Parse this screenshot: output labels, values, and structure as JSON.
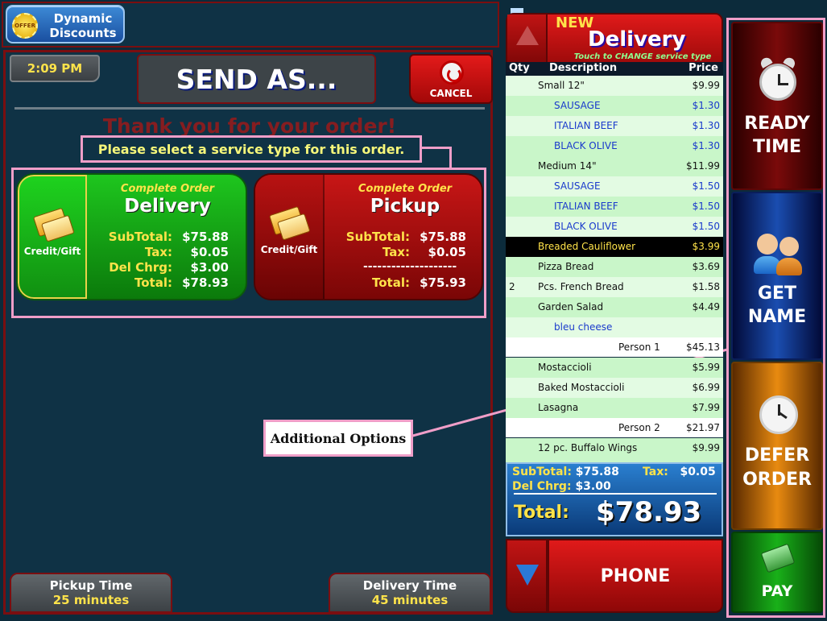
{
  "top": {
    "dynamic_discounts": "Dynamic Discounts",
    "offer_badge": "OFFER"
  },
  "header": {
    "time": "2:09 PM",
    "send_as": "SEND AS...",
    "cancel": "CANCEL"
  },
  "messages": {
    "thanks": "Thank you for your order!",
    "select": "Please select a service type for this order."
  },
  "delivery_card": {
    "credit": "Credit/Gift",
    "label": "Complete Order",
    "title": "Delivery",
    "subtotal_k": "SubTotal:",
    "subtotal_v": "$75.88",
    "tax_k": "Tax:",
    "tax_v": "$0.05",
    "del_k": "Del Chrg:",
    "del_v": "$3.00",
    "total_k": "Total:",
    "total_v": "$78.93"
  },
  "pickup_card": {
    "credit": "Credit/Gift",
    "label": "Complete Order",
    "title": "Pickup",
    "subtotal_k": "SubTotal:",
    "subtotal_v": "$75.88",
    "tax_k": "Tax:",
    "tax_v": "$0.05",
    "dashes": "--------------------",
    "total_k": "Total:",
    "total_v": "$75.93"
  },
  "bottom": {
    "pickup_time_label": "Pickup Time",
    "pickup_time_value": "25 minutes",
    "delivery_time_label": "Delivery Time",
    "delivery_time_value": "45 minutes"
  },
  "annotation": "Additional Options",
  "order": {
    "new": "NEW",
    "service": "Delivery",
    "touch": "Touch to CHANGE service type",
    "col_qty": "Qty",
    "col_desc": "Description",
    "col_price": "Price",
    "rows": [
      {
        "q": "",
        "d": "Small  12\"",
        "p": "$9.99"
      },
      {
        "q": "",
        "d": "SAUSAGE",
        "p": "$1.30"
      },
      {
        "q": "",
        "d": "ITALIAN BEEF",
        "p": "$1.30"
      },
      {
        "q": "",
        "d": "BLACK OLIVE",
        "p": "$1.30"
      },
      {
        "q": "",
        "d": "Medium 14\"",
        "p": "$11.99"
      },
      {
        "q": "",
        "d": "SAUSAGE",
        "p": "$1.50"
      },
      {
        "q": "",
        "d": "ITALIAN BEEF",
        "p": "$1.50"
      },
      {
        "q": "",
        "d": "BLACK OLIVE",
        "p": "$1.50"
      },
      {
        "q": "",
        "d": "Breaded Cauliflower",
        "p": "$3.99"
      },
      {
        "q": "",
        "d": "Pizza Bread",
        "p": "$3.69"
      },
      {
        "q": "2",
        "d": "Pcs. French Bread",
        "p": "$1.58"
      },
      {
        "q": "",
        "d": "Garden Salad",
        "p": "$4.49"
      },
      {
        "q": "",
        "d": "bleu cheese",
        "p": ""
      },
      {
        "q": "",
        "d": "Person 1",
        "p": "$45.13"
      },
      {
        "q": "",
        "d": "Mostaccioli",
        "p": "$5.99"
      },
      {
        "q": "",
        "d": "Baked Mostaccioli",
        "p": "$6.99"
      },
      {
        "q": "",
        "d": "Lasagna",
        "p": "$7.99"
      },
      {
        "q": "",
        "d": "Person 2",
        "p": "$21.97"
      },
      {
        "q": "",
        "d": "12 pc. Buffalo Wings",
        "p": "$9.99"
      }
    ],
    "subtotal_k": "SubTotal:",
    "subtotal_v": "$75.88",
    "tax_k": "Tax:",
    "tax_v": "$0.05",
    "del_k": "Del Chrg:",
    "del_v": "$3.00",
    "total_k": "Total:",
    "total_v": "$78.93",
    "phone": "PHONE"
  },
  "actions": {
    "ready_1": "READY",
    "ready_2": "TIME",
    "name_1": "GET",
    "name_2": "NAME",
    "defer_1": "DEFER",
    "defer_2": "ORDER",
    "pay": "PAY"
  }
}
